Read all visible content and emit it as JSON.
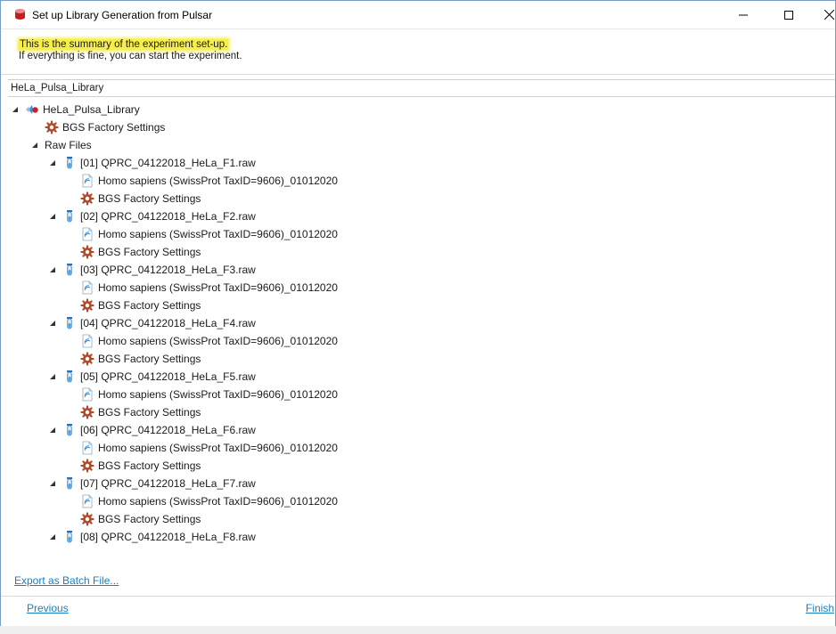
{
  "window": {
    "title": "Set up Library Generation from Pulsar"
  },
  "header": {
    "summary": "This is the summary of the experiment set-up.",
    "hint": "If everything is fine, you can start the experiment."
  },
  "library_name": "HeLa_Pulsa_Library",
  "tree": {
    "root_label": "HeLa_Pulsa_Library",
    "root_settings": "BGS Factory Settings",
    "raw_files_label": "Raw Files",
    "files": [
      {
        "label": "[01]  QPRC_04122018_HeLa_F1.raw",
        "db": "Homo sapiens (SwissProt TaxID=9606)_01012020",
        "settings": "BGS Factory Settings"
      },
      {
        "label": "[02]  QPRC_04122018_HeLa_F2.raw",
        "db": "Homo sapiens (SwissProt TaxID=9606)_01012020",
        "settings": "BGS Factory Settings"
      },
      {
        "label": "[03]  QPRC_04122018_HeLa_F3.raw",
        "db": "Homo sapiens (SwissProt TaxID=9606)_01012020",
        "settings": "BGS Factory Settings"
      },
      {
        "label": "[04]  QPRC_04122018_HeLa_F4.raw",
        "db": "Homo sapiens (SwissProt TaxID=9606)_01012020",
        "settings": "BGS Factory Settings"
      },
      {
        "label": "[05]  QPRC_04122018_HeLa_F5.raw",
        "db": "Homo sapiens (SwissProt TaxID=9606)_01012020",
        "settings": "BGS Factory Settings"
      },
      {
        "label": "[06]  QPRC_04122018_HeLa_F6.raw",
        "db": "Homo sapiens (SwissProt TaxID=9606)_01012020",
        "settings": "BGS Factory Settings"
      },
      {
        "label": "[07]  QPRC_04122018_HeLa_F7.raw",
        "db": "Homo sapiens (SwissProt TaxID=9606)_01012020",
        "settings": "BGS Factory Settings"
      },
      {
        "label": "[08]  QPRC_04122018_HeLa_F8.raw"
      }
    ]
  },
  "footer": {
    "export_label": "Export as Batch File...",
    "previous_label": "Previous",
    "finish_label": "Finish"
  },
  "colors": {
    "highlight": "#f6ef4a",
    "link": "#1a7fc2",
    "window_border": "#7a9cc9"
  }
}
